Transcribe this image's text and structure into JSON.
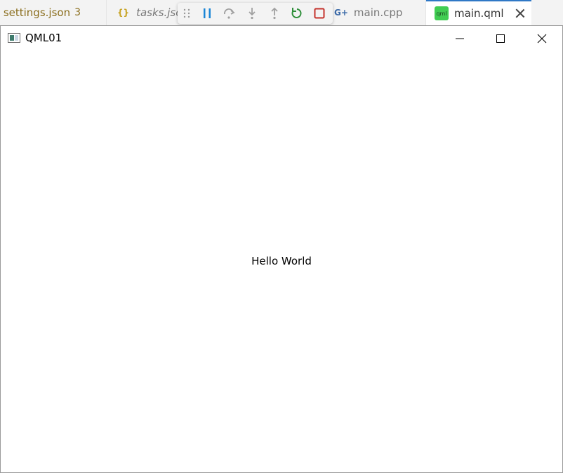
{
  "editor_tabs": {
    "settings": {
      "label": "settings.json",
      "count": "3",
      "icon": "json-icon"
    },
    "tasks": {
      "label": "tasks.json",
      "icon": "braces-icon",
      "braces": "{}"
    },
    "main_cpp": {
      "label": "main.cpp",
      "icon": "cpp-icon",
      "glyph": "G+"
    },
    "main_qml": {
      "label": "main.qml",
      "icon": "qml-icon",
      "badge": "qml",
      "accent": "#2f78c6"
    }
  },
  "debug_toolbar": {
    "buttons": [
      "grip-icon",
      "pause-icon",
      "step-over-icon",
      "step-into-icon",
      "step-out-icon",
      "restart-icon",
      "stop-icon"
    ],
    "colors": {
      "pause": "#1a85d6",
      "restart": "#2f8f3a",
      "stop": "#c4312b",
      "disabled": "#a0a0a0"
    }
  },
  "app_window": {
    "title": "QML01",
    "content_text": "Hello World"
  }
}
